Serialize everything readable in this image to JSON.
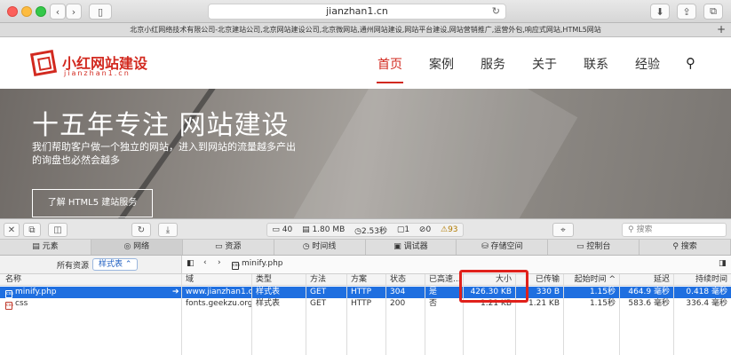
{
  "browser": {
    "url": "jianzhan1.cn",
    "window_title": "北京小红网络技术有限公司-北京建站公司,北京网站建设公司,北京微网站,通州网站建设,网站平台建设,网站营销推广,运营外包,响应式网站,HTML5网站"
  },
  "site": {
    "logo_text": "小红网站建设",
    "logo_sub": "jianzhan1.cn",
    "nav": [
      "首页",
      "案例",
      "服务",
      "关于",
      "联系",
      "经验"
    ],
    "hero_title": "十五年专注 网站建设",
    "hero_subtitle": "我们帮助客户做一个独立的网站，进入到网站的流量越多产出的询盘也必然会越多",
    "hero_button": "了解 HTML5 建站服务"
  },
  "inspector": {
    "stats": {
      "resources": "40",
      "size": "1.80 MB",
      "time": "2.53秒",
      "logs": "1",
      "errors": "0",
      "warnings": "93"
    },
    "search_placeholder": "搜索",
    "tabs": [
      "元素",
      "网络",
      "资源",
      "时间线",
      "调试器",
      "存储空间",
      "控制台",
      "搜索"
    ],
    "filter_label": "所有资源",
    "filter_value": "样式表",
    "path_file": "minify.php",
    "columns": [
      "名称",
      "域",
      "类型",
      "方法",
      "方案",
      "状态",
      "已高速...",
      "大小",
      "已传输",
      "起始时间",
      "延迟",
      "持续时间"
    ],
    "rows": [
      {
        "name": "minify.php",
        "domain": "www.jianzhan1.cn",
        "type": "样式表",
        "method": "GET",
        "scheme": "HTTP",
        "status": "304",
        "cached": "是",
        "size": "426.30 KB",
        "transferred": "330 B",
        "start": "1.15秒",
        "latency": "464.9 毫秒",
        "duration": "0.418 毫秒"
      },
      {
        "name": "css",
        "domain": "fonts.geekzu.org",
        "type": "样式表",
        "method": "GET",
        "scheme": "HTTP",
        "status": "200",
        "cached": "否",
        "size": "1.21 KB",
        "transferred": "1.21 KB",
        "start": "1.15秒",
        "latency": "583.6 毫秒",
        "duration": "336.4 毫秒"
      }
    ]
  },
  "colors": {
    "brand_red": "#d2291f",
    "selection_blue": "#1f6fe0",
    "highlight_red": "#e0211b"
  }
}
